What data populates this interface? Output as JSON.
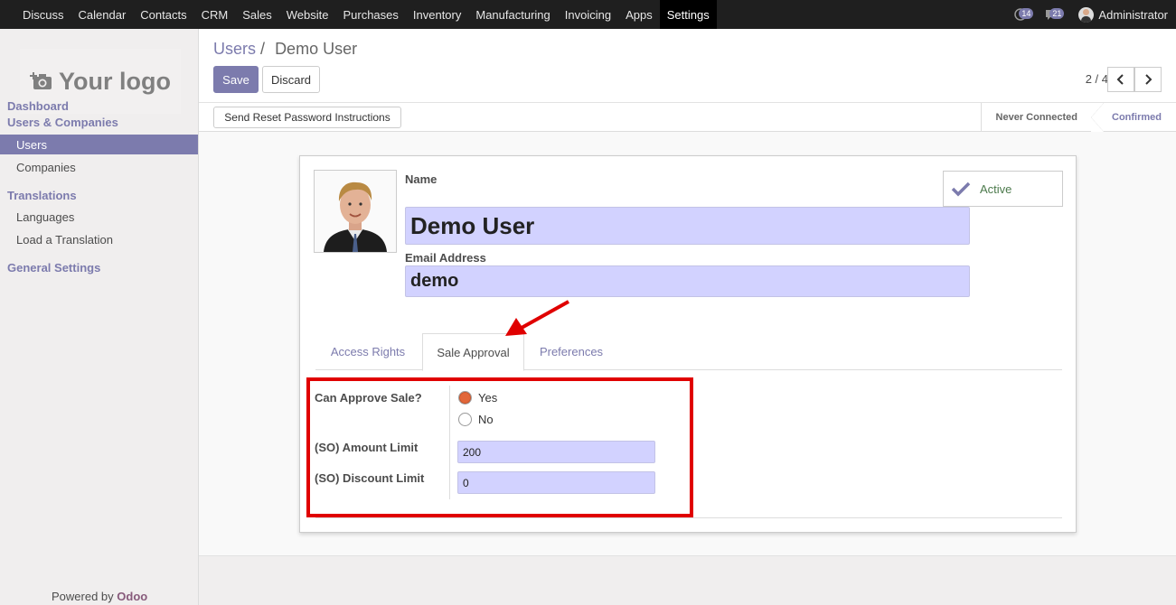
{
  "top_menu": [
    "Discuss",
    "Calendar",
    "Contacts",
    "CRM",
    "Sales",
    "Website",
    "Purchases",
    "Inventory",
    "Manufacturing",
    "Invoicing",
    "Apps",
    "Settings"
  ],
  "top_menu_active": "Settings",
  "systray": {
    "activity_count": "14",
    "message_count": "21",
    "user_name": "Administrator"
  },
  "sidebar": {
    "logo_text": "Your logo",
    "dashboard": "Dashboard",
    "users_companies": "Users & Companies",
    "users": "Users",
    "companies": "Companies",
    "translations": "Translations",
    "languages": "Languages",
    "load_translation": "Load a Translation",
    "general_settings": "General Settings",
    "powered_by": "Powered by",
    "powered_brand": "Odoo"
  },
  "control": {
    "breadcrumb_parent": "Users",
    "breadcrumb_sep": "/",
    "breadcrumb_current": "Demo User",
    "save_label": "Save",
    "discard_label": "Discard",
    "pager": "2 / 4"
  },
  "statusbar": {
    "reset_button": "Send Reset Password Instructions",
    "step_never": "Never Connected",
    "step_confirmed": "Confirmed"
  },
  "form": {
    "name_label": "Name",
    "name_value": "Demo User",
    "email_label": "Email Address",
    "email_value": "demo",
    "active_label": "Active",
    "tabs": [
      "Access Rights",
      "Sale Approval",
      "Preferences"
    ],
    "active_tab": "Sale Approval",
    "can_approve_label": "Can Approve Sale?",
    "yes_label": "Yes",
    "no_label": "No",
    "can_approve_value": "Yes",
    "amount_limit_label": "(SO) Amount Limit",
    "amount_limit_value": "200",
    "discount_limit_label": "(SO) Discount Limit",
    "discount_limit_value": "0"
  },
  "colors": {
    "brand": "#7c7bad",
    "input_bg": "#d2d2ff",
    "annotation_red": "#e00000",
    "radio_checked": "#e2673a"
  }
}
